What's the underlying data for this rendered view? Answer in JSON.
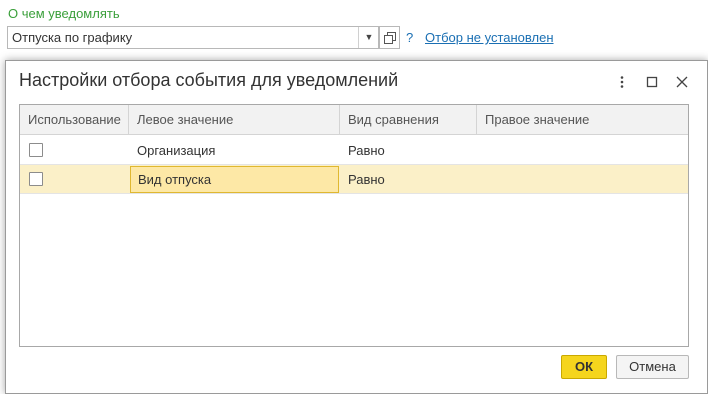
{
  "form": {
    "label": "О чем уведомлять",
    "value": "Отпуска по графику",
    "help": "?",
    "filter_link": "Отбор не установлен"
  },
  "dialog": {
    "title": "Настройки отбора события для уведомлений",
    "columns": [
      "Использование",
      "Левое значение",
      "Вид сравнения",
      "Правое значение"
    ],
    "rows": [
      {
        "checked": false,
        "left": "Организация",
        "comparison": "Равно",
        "right": ""
      },
      {
        "checked": false,
        "left": "Вид отпуска",
        "comparison": "Равно",
        "right": "",
        "selected": true
      }
    ],
    "ok_label": "ОК",
    "cancel_label": "Отмена"
  },
  "icons": [
    "dropdown-arrow-icon",
    "open-icon",
    "more-icon",
    "maximize-icon",
    "close-icon"
  ],
  "colors": {
    "accent_green": "#3a9f3a",
    "link": "#1a6fb3",
    "selection": "#fbf0c8",
    "ok_button": "#f5d51d"
  }
}
